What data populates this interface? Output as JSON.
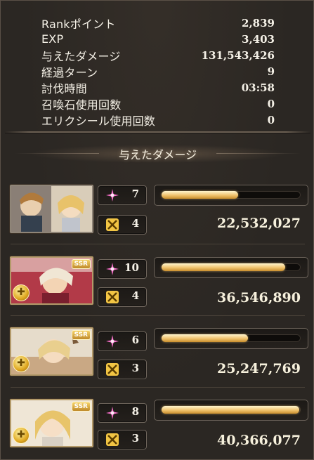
{
  "stats": [
    {
      "label": "Rankポイント",
      "value": "2,839"
    },
    {
      "label": "EXP",
      "value": "3,403"
    },
    {
      "label": "与えたダメージ",
      "value": "131,543,426"
    },
    {
      "label": "経過ターン",
      "value": "9"
    },
    {
      "label": "討伐時間",
      "value": "03:58"
    },
    {
      "label": "召喚石使用回数",
      "value": "0"
    },
    {
      "label": "エリクシール使用回数",
      "value": "0"
    }
  ],
  "section_title": "与えたダメージ",
  "characters": [
    {
      "portrait": "party-portrait",
      "ssr": "",
      "element": "",
      "skill_count": "7",
      "ability_count": "4",
      "damage": "22,532,027",
      "bar_fraction": 0.55
    },
    {
      "portrait": "character-portrait",
      "ssr": "SSR",
      "element": "✚",
      "skill_count": "10",
      "ability_count": "4",
      "damage": "36,546,890",
      "bar_fraction": 0.89
    },
    {
      "portrait": "character-portrait",
      "ssr": "SSR",
      "element": "✚",
      "skill_count": "6",
      "ability_count": "3",
      "damage": "25,247,769",
      "bar_fraction": 0.62
    },
    {
      "portrait": "character-portrait",
      "ssr": "SSR",
      "element": "✚",
      "skill_count": "8",
      "ability_count": "3",
      "damage": "40,366,077",
      "bar_fraction": 0.99
    }
  ],
  "colors": {
    "bar_fill": "#f0c36e",
    "skill_icon": "#f46ec8",
    "ability_icon": "#f2c544",
    "background": "#2b2723"
  }
}
